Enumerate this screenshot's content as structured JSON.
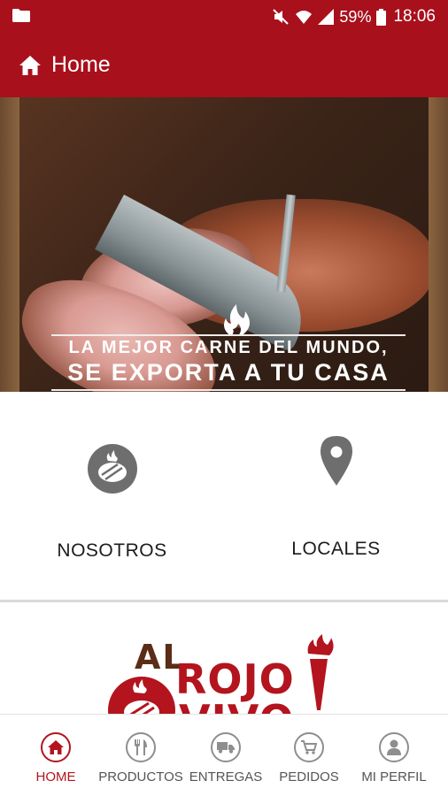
{
  "status_bar": {
    "battery_percent": "59%",
    "time": "18:06",
    "icons": [
      "folder-icon",
      "mute-icon",
      "wifi-icon",
      "signal-icon",
      "battery-icon"
    ]
  },
  "app_bar": {
    "title": "Home",
    "icon": "home-icon"
  },
  "banner": {
    "tagline_line1": "LA MEJOR CARNE DEL MUNDO,",
    "tagline_line2": "SE EXPORTA A TU CASA"
  },
  "options": [
    {
      "label": "NOSOTROS",
      "icon": "grill-steak-icon"
    },
    {
      "label": "LOCALES",
      "icon": "location-pin-icon"
    }
  ],
  "logo": {
    "word1": "AL",
    "word2": "ROJO",
    "word3": "VIVO"
  },
  "bottom_nav": {
    "items": [
      {
        "label": "HOME",
        "icon": "home-icon",
        "active": true
      },
      {
        "label": "PRODUCTOS",
        "icon": "cutlery-icon",
        "active": false
      },
      {
        "label": "ENTREGAS",
        "icon": "truck-icon",
        "active": false
      },
      {
        "label": "PEDIDOS",
        "icon": "cart-icon",
        "active": false
      },
      {
        "label": "MI PERFIL",
        "icon": "user-icon",
        "active": false
      }
    ]
  },
  "colors": {
    "primary": "#a8101c",
    "accent": "#b3141e",
    "icon_gray": "#6e6e6e"
  }
}
